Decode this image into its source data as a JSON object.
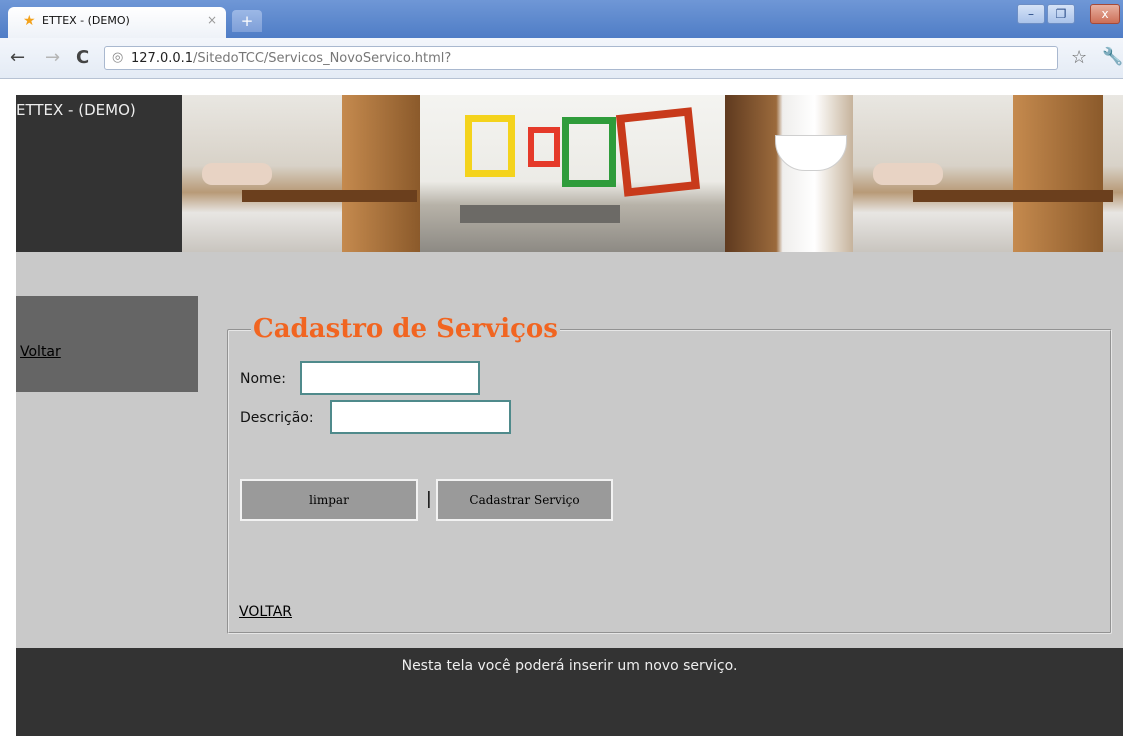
{
  "browser": {
    "tab_title": "ETTEX - (DEMO)",
    "tab_close": "×",
    "new_tab": "+",
    "window_controls": [
      "–",
      "❐",
      "x"
    ],
    "url_host": "127.0.0.1",
    "url_path": "/SitedoTCC/Servicos_NovoServico.html?"
  },
  "header": {
    "brand": "ETTEX - (DEMO)"
  },
  "menu": {
    "back_link": "Voltar"
  },
  "form": {
    "legend": "Cadastro de Serviços",
    "name_label": "Nome:",
    "name_value": "",
    "description_label": "Descrição:",
    "description_value": "",
    "clear_button": "limpar",
    "separator": "|",
    "submit_button": "Cadastrar Serviço",
    "back_link": "VOLTAR"
  },
  "footer": {
    "text": "Nesta tela você poderá inserir um novo serviço."
  },
  "icons": {
    "favicon": "star-icon",
    "back": "arrow-left-icon",
    "forward": "arrow-right-icon",
    "reload": "reload-icon",
    "page": "page-icon",
    "bookmark": "star-outline-icon",
    "menu": "wrench-icon"
  },
  "colors": {
    "legend": "#f16521",
    "content_bg": "#c9c9c9",
    "dark_panel": "#333333",
    "menu_bg": "#656565",
    "input_border": "#4f8a8b"
  }
}
